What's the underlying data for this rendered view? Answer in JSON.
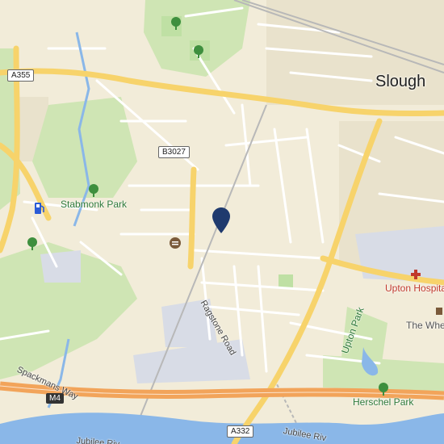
{
  "map": {
    "city_label": "Slough",
    "parks": [
      {
        "name": "Stabmonk Park"
      },
      {
        "name": "Upton Park"
      },
      {
        "name": "Herschel Park"
      }
    ],
    "pois": [
      {
        "name": "Upton Hospital",
        "color": "#c0392b"
      },
      {
        "name": "The Whe",
        "color": "#555555"
      }
    ],
    "streets": [
      {
        "name": "Ragstone Road"
      },
      {
        "name": "Spackmans Way"
      },
      {
        "name": "Jubilee Riv"
      },
      {
        "name": "Jubilee Riv"
      }
    ],
    "road_shields": {
      "a355": "A355",
      "b3027": "B3027",
      "m4": "M4",
      "a332": "A332"
    },
    "colors": {
      "land": "#f2ecd9",
      "major_road": "#f7d36b",
      "motorway": "#f2a45a",
      "water": "#8ab7e8",
      "park": "#c8e6b0",
      "pin": "#1f3a6e"
    },
    "icons": [
      "tree-icon",
      "fuel-icon",
      "restaurant-icon",
      "hospital-icon",
      "location-pin-icon"
    ]
  }
}
